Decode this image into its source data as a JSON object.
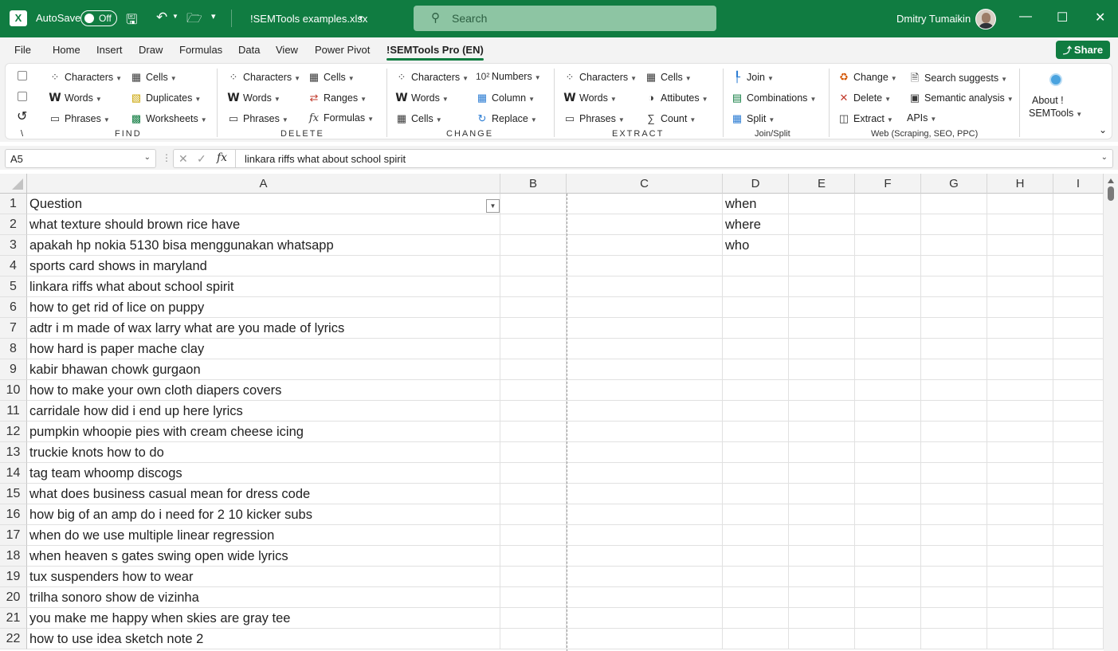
{
  "titlebar": {
    "logo": "X",
    "autosave_label": "AutoSave",
    "autosave_state": "Off",
    "filename": "!SEMTools examples.xlsx",
    "search_placeholder": "Search",
    "user_name": "Dmitry Tumaikin"
  },
  "menu": {
    "tabs": [
      "File",
      "Home",
      "Insert",
      "Draw",
      "Formulas",
      "Data",
      "View",
      "Power Pivot",
      "!SEMTools Pro (EN)"
    ],
    "active_index": 8,
    "share_label": "Share"
  },
  "ribbon": {
    "find": {
      "label": "FIND",
      "items": [
        "Characters",
        "Words",
        "Phrases",
        "Cells",
        "Duplicates",
        "Worksheets"
      ]
    },
    "delete": {
      "label": "DELETE",
      "items": [
        "Characters",
        "Words",
        "Phrases",
        "Cells",
        "Ranges",
        "Formulas"
      ]
    },
    "change": {
      "label": "CHANGE",
      "items": [
        "Characters",
        "Words",
        "Cells",
        "Numbers",
        "Column",
        "Replace"
      ]
    },
    "extract": {
      "label": "EXTRACT",
      "items": [
        "Characters",
        "Words",
        "Phrases",
        "Cells",
        "Attibutes",
        "Count"
      ]
    },
    "joinsplit": {
      "label": "Join/Split",
      "items": [
        "Join",
        "Combinations",
        "Split"
      ]
    },
    "web": {
      "label": "Web (Scraping, SEO, PPC)",
      "items": [
        "Change",
        "Delete",
        "Extract",
        "Search suggests",
        "Semantic analysis",
        "APIs"
      ]
    },
    "about": {
      "line1": "About !",
      "line2": "SEMTools"
    }
  },
  "formula_bar": {
    "name_box": "A5",
    "formula": "linkara riffs what about school spirit"
  },
  "grid": {
    "columns": [
      "A",
      "B",
      "C",
      "D",
      "E",
      "F",
      "G",
      "H",
      "I"
    ],
    "rows": [
      {
        "n": "1",
        "a": "Question",
        "d": "when"
      },
      {
        "n": "2",
        "a": "what texture should brown rice have",
        "d": "where"
      },
      {
        "n": "3",
        "a": "apakah hp nokia 5130 bisa menggunakan whatsapp",
        "d": "who"
      },
      {
        "n": "4",
        "a": "sports card shows in maryland",
        "d": ""
      },
      {
        "n": "5",
        "a": "linkara riffs what about school spirit",
        "d": ""
      },
      {
        "n": "6",
        "a": "how to get rid of lice on puppy",
        "d": ""
      },
      {
        "n": "7",
        "a": "adtr i m made of wax larry what are you made of lyrics",
        "d": ""
      },
      {
        "n": "8",
        "a": "how hard is paper mache clay",
        "d": ""
      },
      {
        "n": "9",
        "a": "kabir bhawan chowk gurgaon",
        "d": ""
      },
      {
        "n": "10",
        "a": "how to make your own cloth diapers covers",
        "d": ""
      },
      {
        "n": "11",
        "a": "carridale how did i end up here lyrics",
        "d": ""
      },
      {
        "n": "12",
        "a": "pumpkin whoopie pies with cream cheese icing",
        "d": ""
      },
      {
        "n": "13",
        "a": "truckie knots how to do",
        "d": ""
      },
      {
        "n": "14",
        "a": "tag team whoomp discogs",
        "d": ""
      },
      {
        "n": "15",
        "a": "what does business casual mean for dress code",
        "d": ""
      },
      {
        "n": "16",
        "a": "how big of an amp do i need for 2 10 kicker subs",
        "d": ""
      },
      {
        "n": "17",
        "a": "when do we use multiple linear regression",
        "d": ""
      },
      {
        "n": "18",
        "a": "when heaven s gates swing open wide lyrics",
        "d": ""
      },
      {
        "n": "19",
        "a": "tux suspenders how to wear",
        "d": ""
      },
      {
        "n": "20",
        "a": "trilha sonoro show de vizinha",
        "d": ""
      },
      {
        "n": "21",
        "a": "you make me happy when skies are gray tee",
        "d": ""
      },
      {
        "n": "22",
        "a": "how to use idea sketch note 2",
        "d": ""
      }
    ]
  }
}
